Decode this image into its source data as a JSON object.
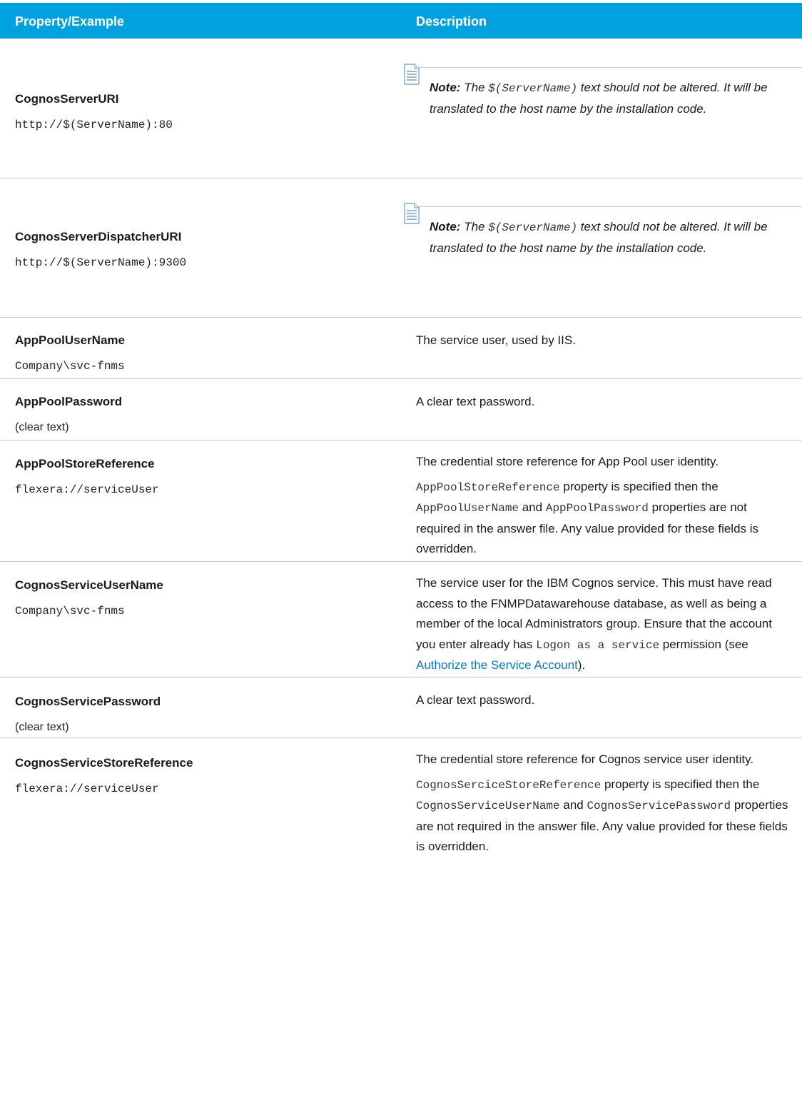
{
  "header": {
    "col_property": "Property/Example",
    "col_description": "Description"
  },
  "note": {
    "label": "Note:",
    "pre": "The",
    "code": "$(ServerName)",
    "post": "text should not be altered. It will be translated to the host name by the installation code."
  },
  "rows": [
    {
      "name": "CognosServerURI",
      "example": "http://$(ServerName):80"
    },
    {
      "name": "CognosServerDispatcherURI",
      "example": "http://$(ServerName):9300"
    },
    {
      "name": "AppPoolUserName",
      "example": "Company\\svc-fnms",
      "desc": "The service user, used by IIS."
    },
    {
      "name": "AppPoolPassword",
      "example": "(clear text)",
      "desc": "A clear text password."
    },
    {
      "name": "AppPoolStoreReference",
      "example": "flexera://serviceUser",
      "desc1": "The credential store reference for App Pool user identity.",
      "p2": {
        "code1": "AppPoolStoreReference",
        "t1": " property is specified then the ",
        "code2": "AppPoolUserName",
        "t2": " and ",
        "code3": "AppPoolPassword",
        "t3": " properties are not required in the answer file. Any value provided for these fields is overridden."
      }
    },
    {
      "name": "CognosServiceUserName",
      "example": "Company\\svc-fnms",
      "d": {
        "t1": "The service user for the IBM Cognos service. This must have read access to the FNMPDatawarehouse database, as well as being a member of the local Administrators group. Ensure that the account you enter already has ",
        "code": "Logon as a service",
        "t2": " permission (see ",
        "link": "Authorize the Service Account",
        "t3": ")."
      }
    },
    {
      "name": "CognosServicePassword",
      "example": "(clear text)",
      "desc": "A clear text password."
    },
    {
      "name": "CognosServiceStoreReference",
      "example": "flexera://serviceUser",
      "desc1": "The credential store reference for Cognos service user identity.",
      "p2": {
        "code1": "CognosSerciceStoreReference",
        "t1": " property is specified then the ",
        "code2": "CognosServiceUserName",
        "t2": " and ",
        "code3": "CognosServicePassword",
        "t3": " properties are not required in the answer file. Any value provided for these fields is overridden."
      }
    }
  ]
}
